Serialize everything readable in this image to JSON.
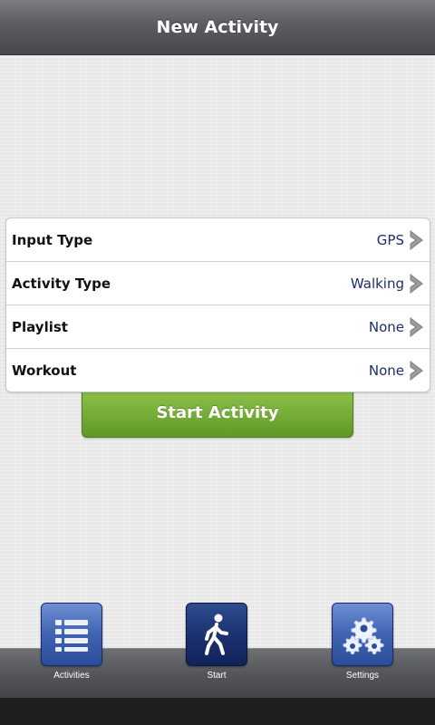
{
  "header": {
    "title": "New Activity"
  },
  "settings": [
    {
      "label": "Input Type",
      "value": "GPS"
    },
    {
      "label": "Activity Type",
      "value": "Walking"
    },
    {
      "label": "Playlist",
      "value": "None"
    },
    {
      "label": "Workout",
      "value": "None"
    }
  ],
  "start_button": {
    "label": "Start Activity"
  },
  "tabs": [
    {
      "label": "Activities",
      "icon": "list-icon",
      "active": false
    },
    {
      "label": "Start",
      "icon": "walking-person-icon",
      "active": true
    },
    {
      "label": "Settings",
      "icon": "gears-icon",
      "active": false
    }
  ],
  "colors": {
    "title_bar": "#5a5c5f",
    "accent_green": "#76ad37",
    "value_text": "#1c2f6a",
    "tab_blue": "#3f63b2",
    "tab_active": "#1c3270"
  }
}
